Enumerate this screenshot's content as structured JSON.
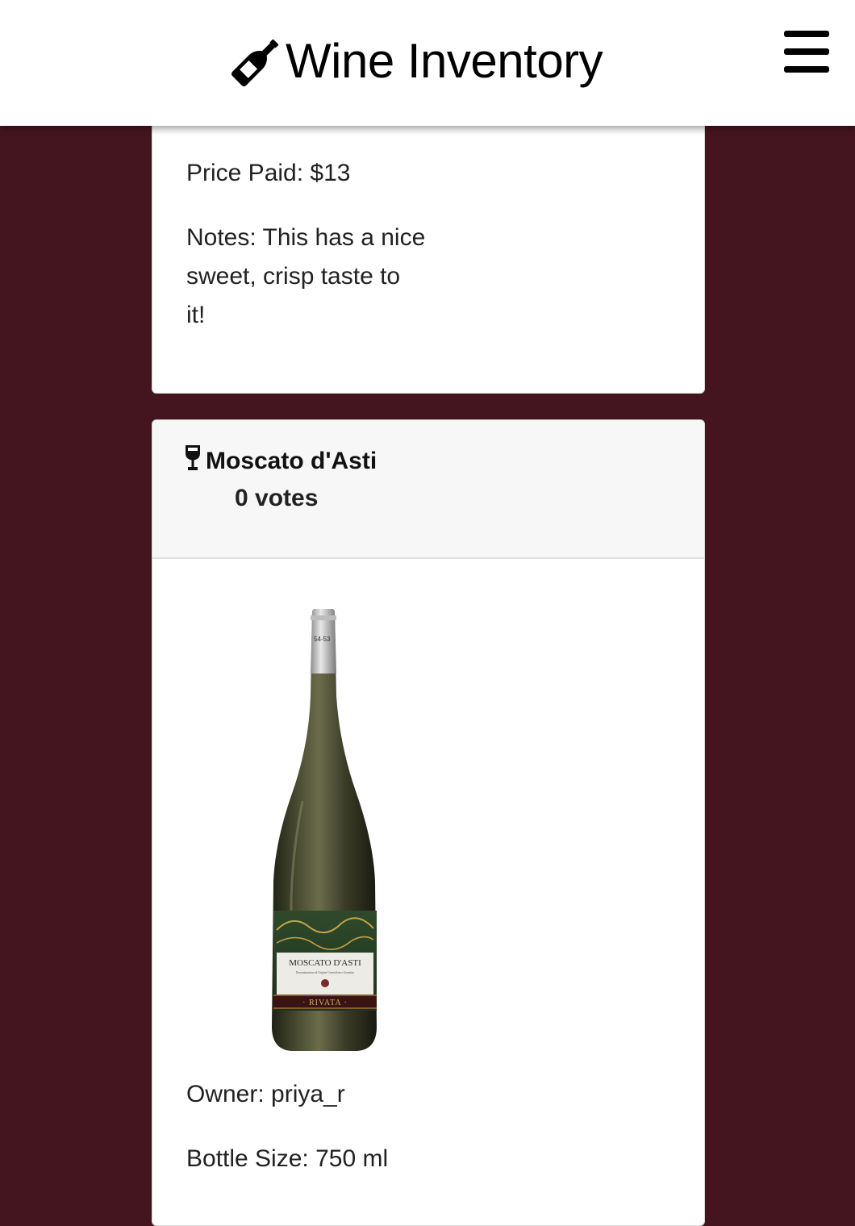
{
  "navbar": {
    "brand_title": "Wine Inventory",
    "brand_icon": "wine-bottle-icon",
    "menu_icon": "hamburger-menu-icon"
  },
  "previous_card": {
    "price_paid": "Price Paid: $13",
    "notes_lines": [
      "Notes: This has a nice",
      "sweet, crisp taste to",
      "it!"
    ]
  },
  "wine_card": {
    "title_icon": "wine-glass-icon",
    "name": "Moscato d'Asti",
    "votes": "0 votes",
    "label_name": "MOSCATO D'ASTI",
    "label_subtext": "Denominazione di Origine Controllata e Garantita",
    "label_brand": "· RIVATA ·",
    "neck_code": "54-53",
    "owner": "Owner: priya_r",
    "bottle_size": "Bottle Size: 750 ml"
  },
  "colors": {
    "page_background": "#45151f",
    "navbar_background": "#ffffff",
    "card_background": "#ffffff",
    "card_header_background": "#f7f7f7"
  }
}
